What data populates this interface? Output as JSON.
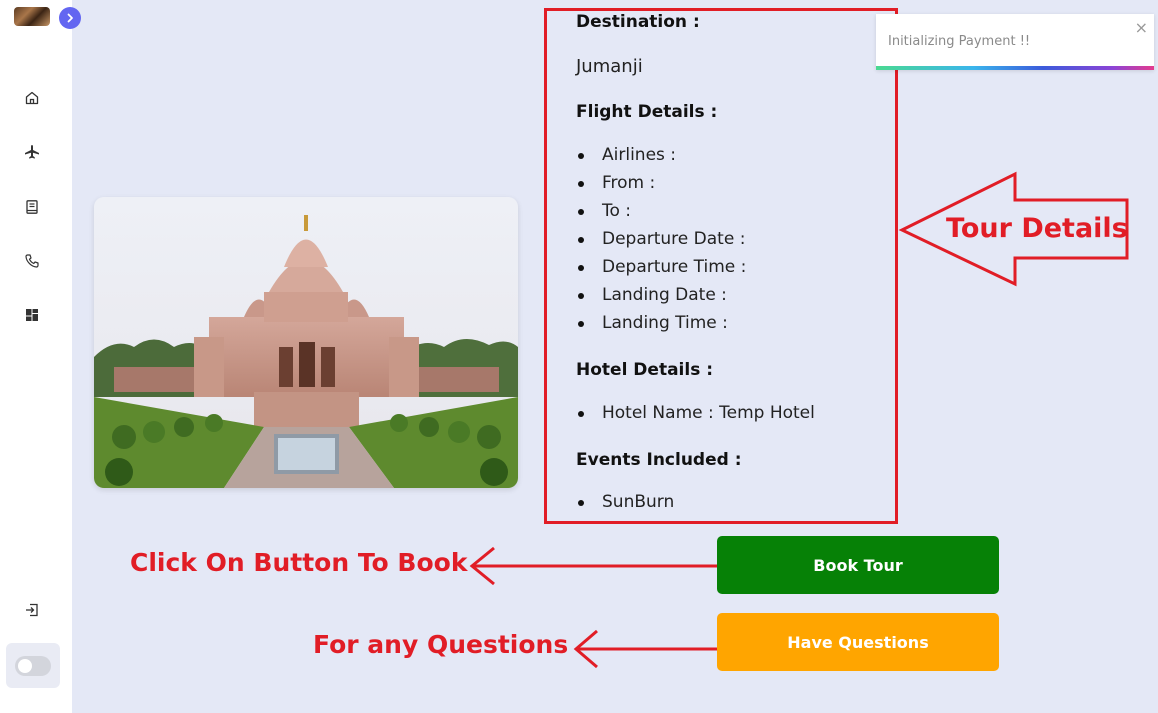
{
  "toast": {
    "message": "Initializing Payment !!",
    "close": "×"
  },
  "sidebar": {
    "icons": [
      "home-icon",
      "plane-icon",
      "book-icon",
      "phone-icon",
      "dashboard-icon"
    ],
    "logout_icon": "logout-icon"
  },
  "tour": {
    "destination_title": "Destination :",
    "destination": "Jumanji",
    "flight_title": "Flight Details :",
    "flight_items": [
      "Airlines :",
      "From :",
      "To :",
      "Departure Date :",
      "Departure Time :",
      "Landing Date :",
      "Landing Time :"
    ],
    "hotel_title": "Hotel Details :",
    "hotel_items": [
      "Hotel Name : Temp Hotel"
    ],
    "events_title": "Events Included :",
    "events_items": [
      "SunBurn"
    ]
  },
  "buttons": {
    "book": "Book Tour",
    "questions": "Have Questions"
  },
  "annotations": {
    "tour_details": "Tour Details",
    "click_to_book": "Click On Button To Book",
    "for_questions": "For any Questions"
  },
  "colors": {
    "annotation_red": "#e11d26",
    "book_green": "#068106",
    "questions_orange": "#ffa500",
    "accent_indigo": "#6366f1",
    "background": "#e4e8f6"
  }
}
